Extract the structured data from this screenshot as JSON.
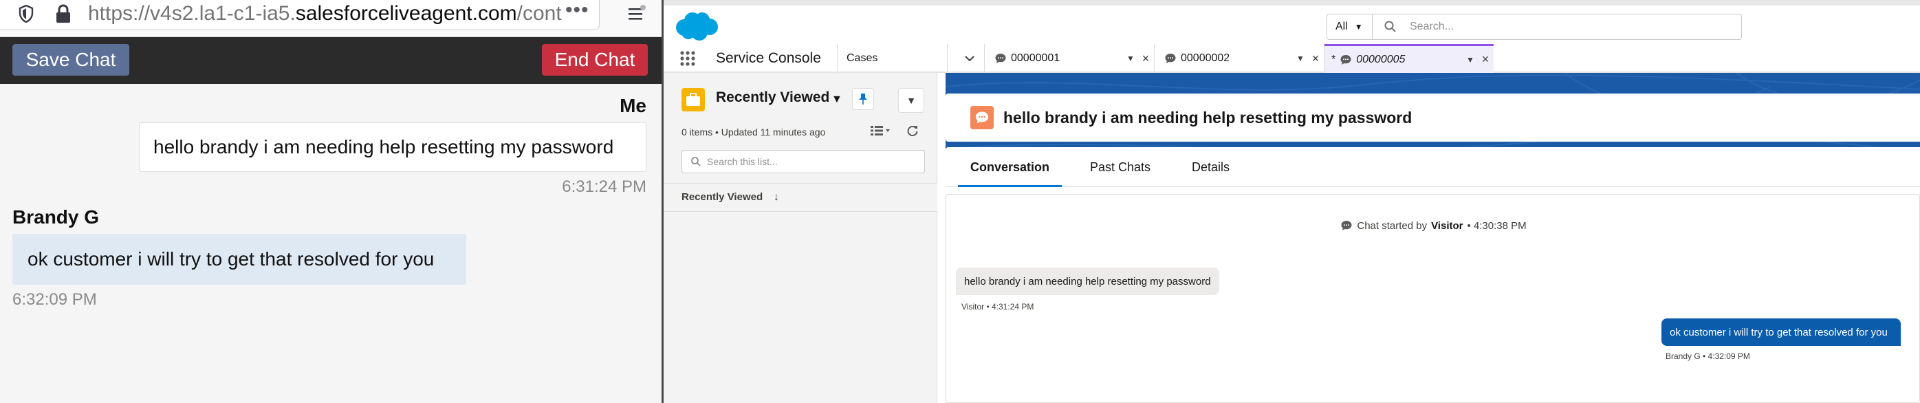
{
  "browser": {
    "url_prefix": "https://v4s2.la1-c1-ia5.",
    "url_domain": "salesforceliveagent.com",
    "url_suffix": "/conte",
    "more": "•••"
  },
  "chat_window": {
    "save_label": "Save Chat",
    "end_label": "End Chat",
    "messages": [
      {
        "sender": "Me",
        "text": "hello brandy i am needing help resetting my password",
        "time": "6:31:24 PM"
      },
      {
        "sender": "Brandy G",
        "text": "ok customer i will try to get that resolved for you",
        "time": "6:32:09 PM"
      }
    ]
  },
  "console": {
    "search_scope": "All",
    "search_placeholder": "Search...",
    "app_name": "Service Console",
    "object_menu": "Cases",
    "tabs": [
      {
        "label": "00000001",
        "unsaved": ""
      },
      {
        "label": "00000002",
        "unsaved": ""
      },
      {
        "label": "00000005",
        "unsaved": "*"
      }
    ],
    "list_view": {
      "title": "Recently Viewed",
      "meta": "0 items • Updated 11 minutes ago",
      "search_placeholder": "Search this list...",
      "column": "Recently Viewed"
    },
    "record": {
      "title": "hello brandy i am needing help resetting my password",
      "sub_tabs": [
        "Conversation",
        "Past Chats",
        "Details"
      ],
      "started_prefix": "Chat started by",
      "started_by": "Visitor",
      "started_time": "• 4:30:38 PM",
      "transcript": [
        {
          "text": "hello brandy i am needing help resetting my password",
          "meta": "Visitor • 4:31:24 PM"
        },
        {
          "text": "ok customer i will try to get that resolved for you",
          "meta": "Brandy G • 4:32:09 PM"
        }
      ]
    }
  },
  "colors": {
    "salesforce_blue": "#00a1e0",
    "end_chat_red": "#c8303f",
    "save_chat_slate": "#5c6f96",
    "active_tab_purple": "#9050e9",
    "agent_bubble": "#0b5cab"
  },
  "icons": [
    "shield-icon",
    "lock-icon",
    "hamburger-menu-icon",
    "salesforce-logo",
    "search-icon",
    "app-launcher-icon",
    "chat-icon",
    "pin-icon",
    "refresh-icon",
    "list-display-icon",
    "sort-arrow-icon",
    "briefcase-icon"
  ]
}
